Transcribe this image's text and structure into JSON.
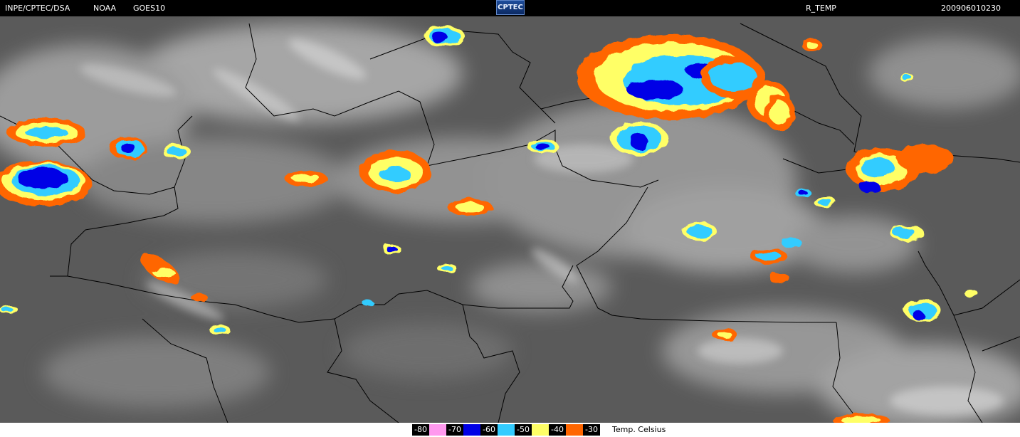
{
  "header": {
    "source": "INPE/CPTEC/DSA",
    "agency": "NOAA",
    "satellite": "GOES10",
    "logo_text": "CPTEC",
    "product": "R_TEMP",
    "timestamp": "200906010230"
  },
  "legend": {
    "caption": "Temp. Celsius",
    "items": [
      {
        "label": "-80",
        "color": "#ff99ee"
      },
      {
        "label": "-70",
        "color": "#0000e6"
      },
      {
        "label": "-60",
        "color": "#33ccff"
      },
      {
        "label": "-50",
        "color": "#ffff66"
      },
      {
        "label": "-40",
        "color": "#ff6600"
      },
      {
        "label": "-30",
        "color": ""
      }
    ]
  },
  "colors": {
    "background_cloud": "#5a5a5a",
    "cloud_light": "#c8c8c8",
    "border_lines": "#000000"
  }
}
